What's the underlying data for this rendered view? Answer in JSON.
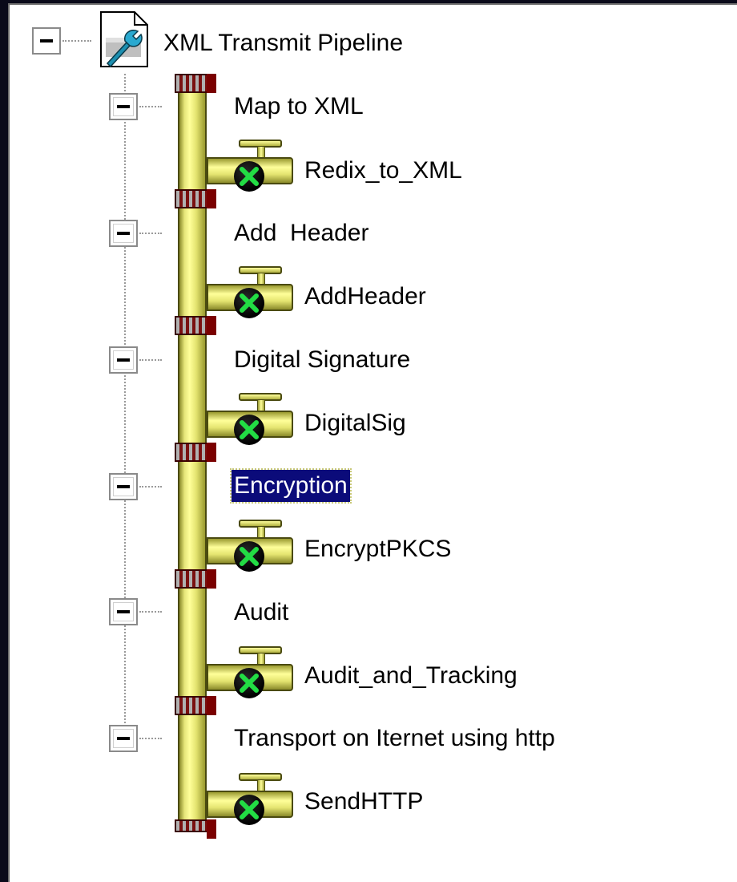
{
  "tree": {
    "root": {
      "label": "XML Transmit Pipeline",
      "icon": "pipeline-document-icon"
    },
    "stages": [
      {
        "label": "Map to XML",
        "component": {
          "label": "Redix_to_XML",
          "status": "valve-green-check-icon"
        }
      },
      {
        "label": "Add  Header",
        "component": {
          "label": "AddHeader",
          "status": "valve-green-check-icon"
        }
      },
      {
        "label": "Digital Signature",
        "component": {
          "label": "DigitalSig",
          "status": "valve-green-check-icon"
        }
      },
      {
        "label": "Encryption",
        "selected": true,
        "component": {
          "label": "EncryptPKCS",
          "status": "valve-green-check-icon"
        }
      },
      {
        "label": "Audit",
        "component": {
          "label": "Audit_and_Tracking",
          "status": "valve-green-check-icon"
        }
      },
      {
        "label": "Transport on Iternet using http",
        "component": {
          "label": "SendHTTP",
          "status": "valve-green-check-icon"
        }
      }
    ]
  },
  "colors": {
    "selection_bg": "#0b0b7a",
    "pipe": "#e6e67a",
    "joint": "#7a1010",
    "status_check": "#22dd44"
  }
}
